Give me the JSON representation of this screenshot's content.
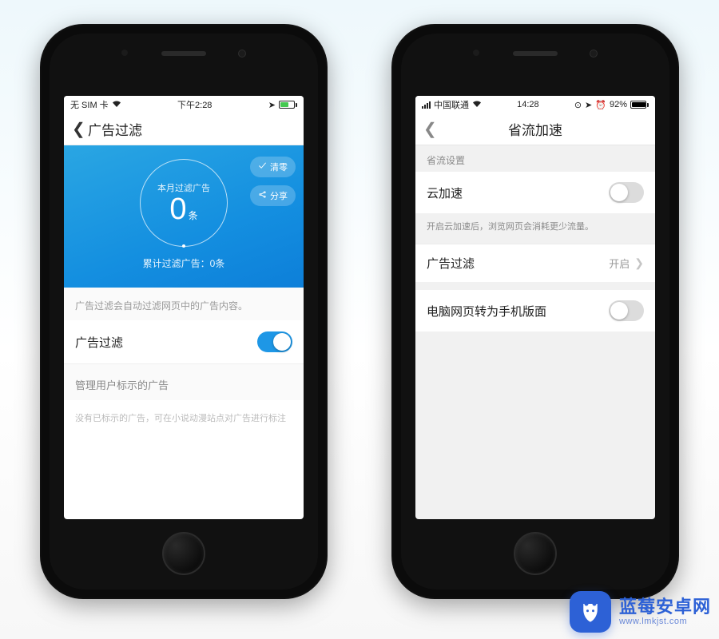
{
  "phone1": {
    "statusbar": {
      "carrier": "无 SIM 卡",
      "wifi": true,
      "time": "下午2:28",
      "battery": {
        "color": "#45c950",
        "width_pct": 55
      }
    },
    "nav": {
      "title": "广告过滤"
    },
    "hero": {
      "ring_label": "本月过滤广告",
      "ring_value": "0",
      "ring_unit": "条",
      "total_label": "累计过滤广告：0条",
      "actions": {
        "clear": {
          "label": "清零",
          "icon": "clear-icon"
        },
        "share": {
          "label": "分享",
          "icon": "share-icon"
        }
      }
    },
    "filter_note": "广告过滤会自动过滤网页中的广告内容。",
    "filter_cell": {
      "label": "广告过滤",
      "on": true
    },
    "manage": {
      "header": "管理用户标示的广告",
      "empty": "没有已标示的广告，可在小说动漫站点对广告进行标注"
    }
  },
  "phone2": {
    "statusbar": {
      "carrier": "中国联通",
      "wifi": true,
      "time": "14:28",
      "right_text": "92%",
      "battery": {
        "color": "#000",
        "width_pct": 92
      }
    },
    "nav": {
      "title": "省流加速"
    },
    "group1": {
      "title": "省流设置",
      "cloud": {
        "label": "云加速",
        "on": false
      },
      "note": "开启云加速后，浏览网页会消耗更少流量。"
    },
    "adfilter": {
      "label": "广告过滤",
      "value": "开启"
    },
    "desktop": {
      "label": "电脑网页转为手机版面",
      "on": false
    }
  },
  "watermark": {
    "main": "蓝莓安卓网",
    "sub": "www.lmkjst.com"
  }
}
